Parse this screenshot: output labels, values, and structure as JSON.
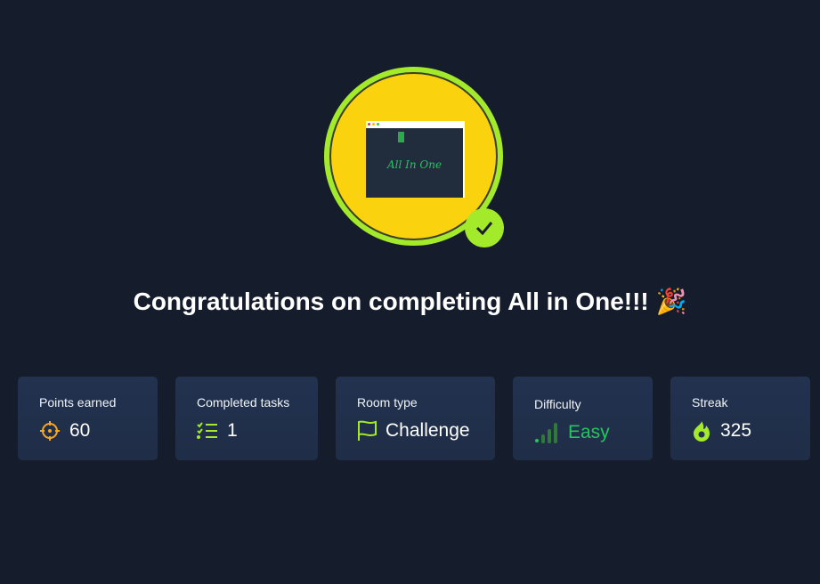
{
  "badge": {
    "image_text": "All In One",
    "status": "completed"
  },
  "title": "Congratulations on completing All in One!!! 🎉",
  "stats": [
    {
      "label": "Points earned",
      "value": "60",
      "icon": "crosshair-icon",
      "color": "#f5a623"
    },
    {
      "label": "Completed tasks",
      "value": "1",
      "icon": "checklist-icon",
      "color": "#a3ea2a"
    },
    {
      "label": "Room type",
      "value": "Challenge",
      "icon": "flag-icon",
      "color": "#a3ea2a"
    },
    {
      "label": "Difficulty",
      "value": "Easy",
      "icon": "signal-bars-icon",
      "color": "#22c55e"
    },
    {
      "label": "Streak",
      "value": "325",
      "icon": "flame-icon",
      "color": "#a3ea2a"
    }
  ]
}
